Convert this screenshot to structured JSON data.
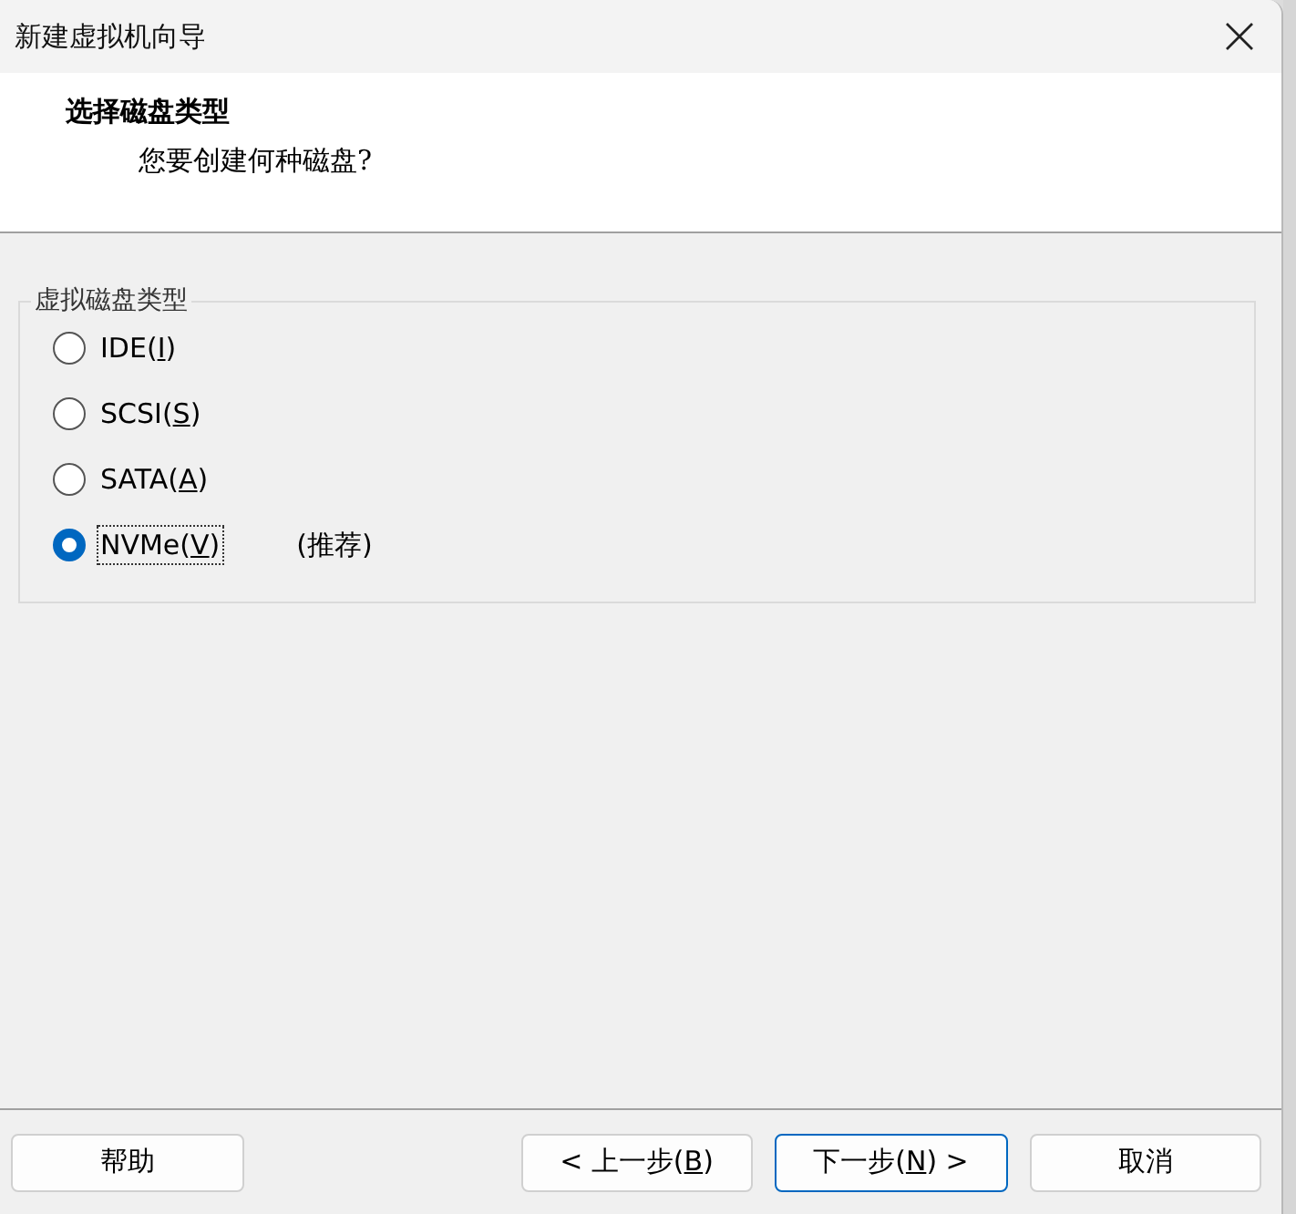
{
  "window": {
    "title": "新建虚拟机向导"
  },
  "header": {
    "title": "选择磁盘类型",
    "subtitle": "您要创建何种磁盘?"
  },
  "group": {
    "legend": "虚拟磁盘类型",
    "options": [
      {
        "label_start": "IDE(",
        "access_key": "I",
        "label_end": ")",
        "selected": false
      },
      {
        "label_start": "SCSI(",
        "access_key": "S",
        "label_end": ")",
        "selected": false
      },
      {
        "label_start": "SATA(",
        "access_key": "A",
        "label_end": ")",
        "selected": false
      },
      {
        "label_start": "NVMe(",
        "access_key": "V",
        "label_end": ")",
        "selected": true,
        "note": "(推荐)"
      }
    ]
  },
  "buttons": [
    {
      "label_start": "帮助",
      "kind": "help"
    },
    {
      "label_start": "< 上一步(",
      "access_key": "B",
      "label_end": ")",
      "kind": "nav"
    },
    {
      "label_start": "下一步(",
      "access_key": "N",
      "label_end": ") >",
      "kind": "default"
    },
    {
      "label_start": "取消",
      "kind": "nav"
    }
  ]
}
